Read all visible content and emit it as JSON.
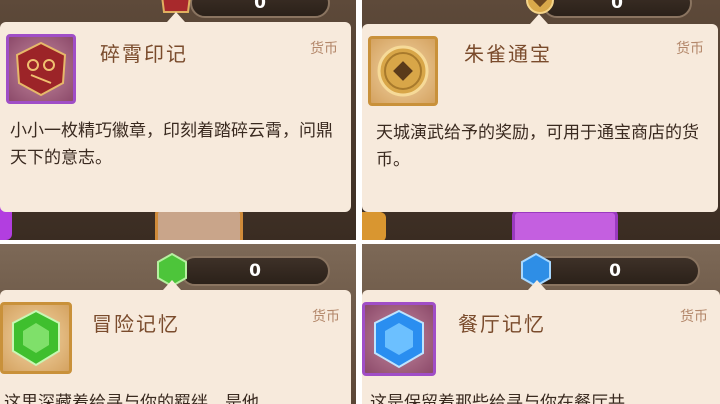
{
  "items": [
    {
      "name": "碎霄印记",
      "category": "货币",
      "description": "小小一枚精巧徽章，印刻着踏碎云霄，问鼎天下的意志。",
      "count": "0",
      "icon": "red-badge-icon",
      "rarity_color": "#a04ec7"
    },
    {
      "name": "朱雀通宝",
      "category": "货币",
      "description": "天城演武给予的奖励，可用于通宝商店的货币。",
      "count": "0",
      "icon": "gold-coin-icon",
      "rarity_color": "#c9913a"
    },
    {
      "name": "冒险记忆",
      "category": "货币",
      "description": "这里深藏着给寻与你的羁绊，是他",
      "count": "0",
      "icon": "green-gem-icon",
      "rarity_color": "#c9913a"
    },
    {
      "name": "餐厅记忆",
      "category": "货币",
      "description": "这是保留着那些给寻与你在餐厅共",
      "count": "0",
      "icon": "blue-gem-icon",
      "rarity_color": "#a04ec7"
    }
  ]
}
